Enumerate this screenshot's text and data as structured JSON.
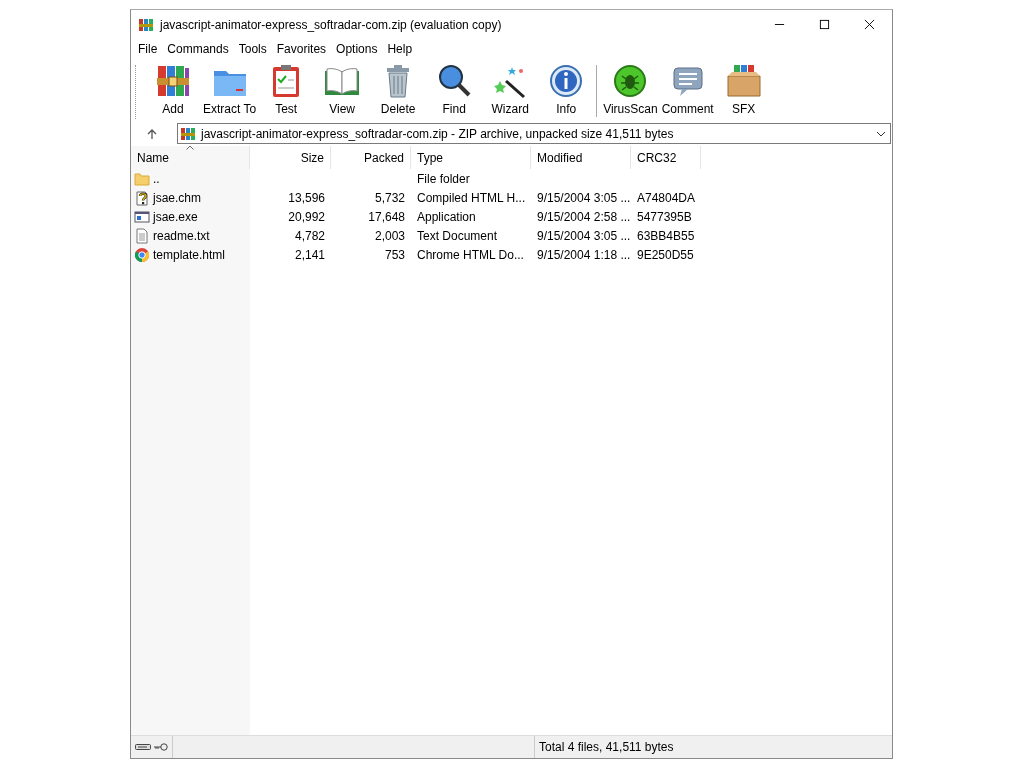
{
  "window": {
    "title": "javascript-animator-express_softradar-com.zip (evaluation copy)"
  },
  "menu": [
    "File",
    "Commands",
    "Tools",
    "Favorites",
    "Options",
    "Help"
  ],
  "toolbar": [
    {
      "label": "Add",
      "kind": "books"
    },
    {
      "label": "Extract To",
      "kind": "folder"
    },
    {
      "label": "Test",
      "kind": "clipboard"
    },
    {
      "label": "View",
      "kind": "book"
    },
    {
      "label": "Delete",
      "kind": "bin"
    },
    {
      "label": "Find",
      "kind": "magnifier"
    },
    {
      "label": "Wizard",
      "kind": "wand"
    },
    {
      "label": "Info",
      "kind": "info"
    },
    {
      "label": "VirusScan",
      "kind": "bug",
      "separated": true
    },
    {
      "label": "Comment",
      "kind": "bubble"
    },
    {
      "label": "SFX",
      "kind": "box"
    }
  ],
  "address": {
    "value": "javascript-animator-express_softradar-com.zip - ZIP archive, unpacked size 41,511 bytes"
  },
  "table": {
    "columns": [
      {
        "label": "Name",
        "sorted": true
      },
      {
        "label": "Size",
        "sorted": false
      },
      {
        "label": "Packed",
        "sorted": false
      },
      {
        "label": "Type",
        "sorted": false
      },
      {
        "label": "Modified",
        "sorted": false
      },
      {
        "label": "CRC32",
        "sorted": false
      }
    ],
    "rows": [
      {
        "kind": "folder",
        "cells": [
          "..",
          "",
          "",
          "File folder",
          "",
          ""
        ]
      },
      {
        "kind": "help",
        "cells": [
          "jsae.chm",
          "13,596",
          "5,732",
          "Compiled HTML H...",
          "9/15/2004 3:05 ...",
          "A74804DA"
        ]
      },
      {
        "kind": "app",
        "cells": [
          "jsae.exe",
          "20,992",
          "17,648",
          "Application",
          "9/15/2004 2:58 ...",
          "5477395B"
        ]
      },
      {
        "kind": "text",
        "cells": [
          "readme.txt",
          "4,782",
          "2,003",
          "Text Document",
          "9/15/2004 3:05 ...",
          "63BB4B55"
        ]
      },
      {
        "kind": "chrome",
        "cells": [
          "template.html",
          "2,141",
          "753",
          "Chrome HTML Do...",
          "9/15/2004 1:18 ...",
          "9E250D55"
        ]
      }
    ]
  },
  "status_bar": {
    "text": "Total 4 files, 41,511 bytes"
  }
}
